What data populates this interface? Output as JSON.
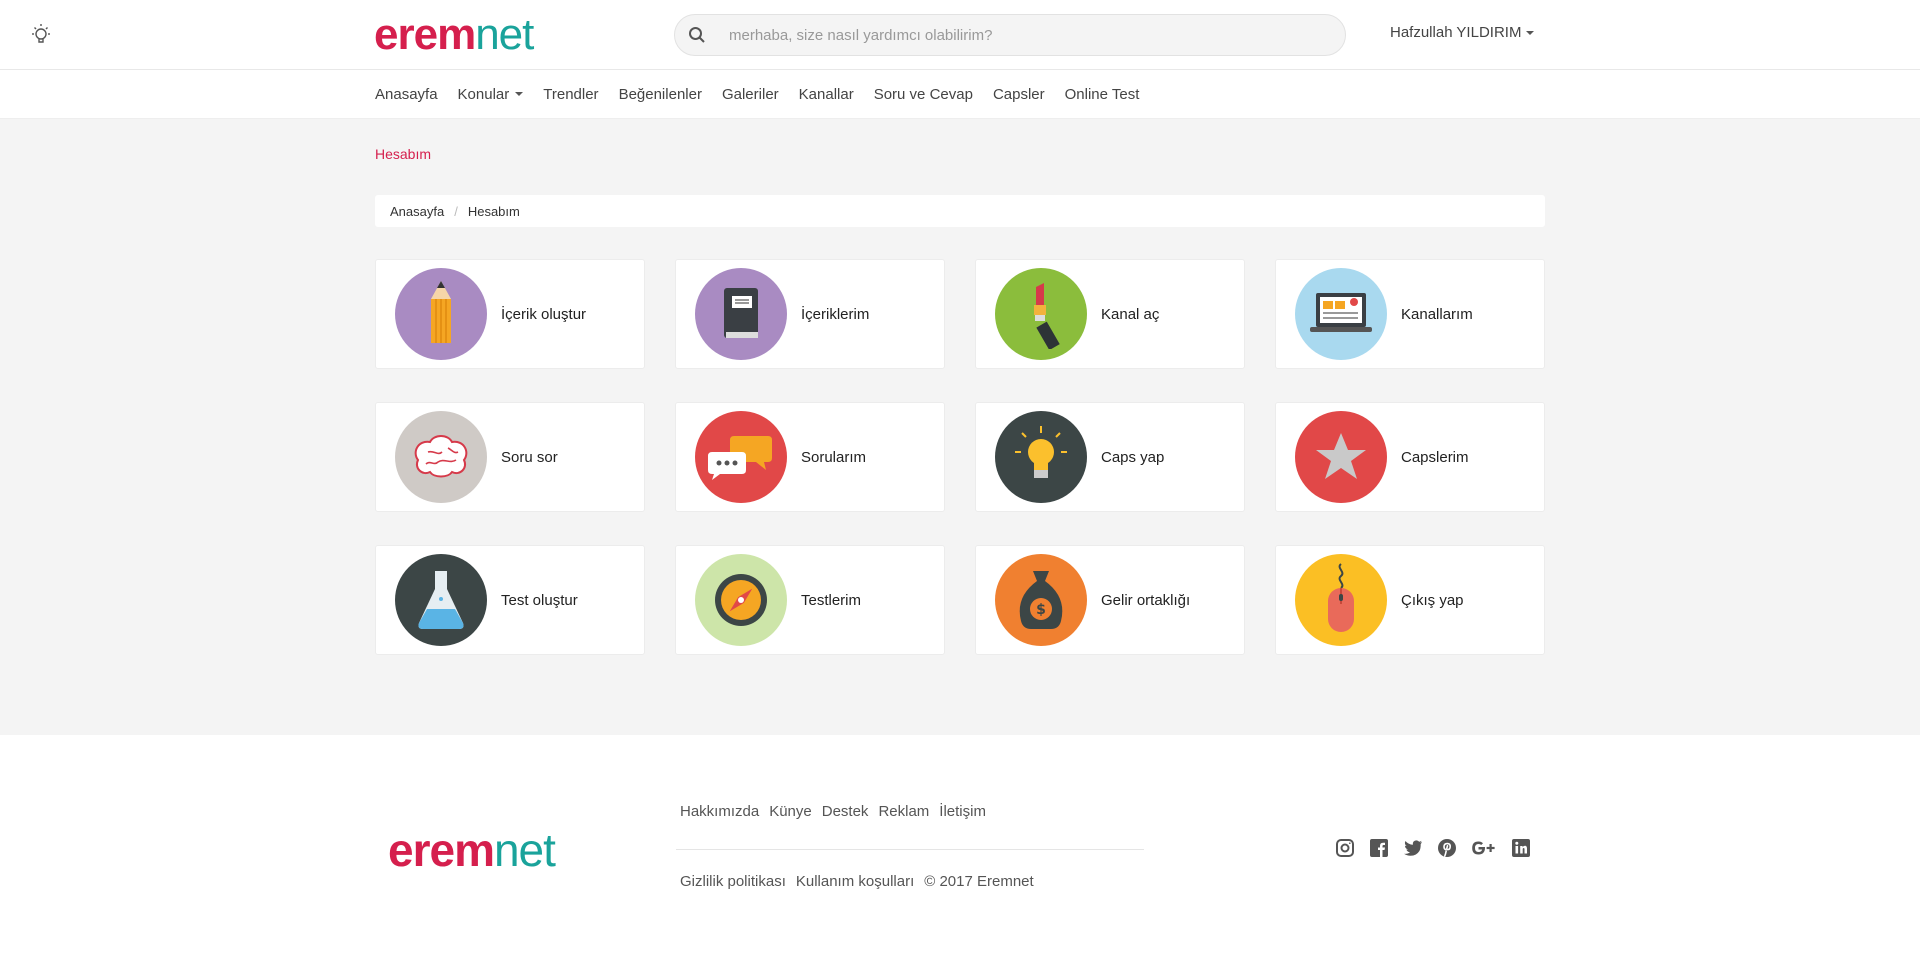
{
  "header": {
    "logo_left": "erem",
    "logo_right": "net",
    "search_placeholder": "merhaba, size nasıl yardımcı olabilirim?",
    "user_name": "Hafzullah YILDIRIM"
  },
  "nav": {
    "items": [
      "Anasayfa",
      "Konular",
      "Trendler",
      "Beğenilenler",
      "Galeriler",
      "Kanallar",
      "Soru ve Cevap",
      "Capsler",
      "Online Test"
    ]
  },
  "page": {
    "title": "Hesabım",
    "breadcrumb": [
      "Anasayfa",
      "Hesabım"
    ]
  },
  "cards": [
    {
      "label": "İçerik oluştur",
      "color": "#a98bc2",
      "icon": "pencil-icon"
    },
    {
      "label": "İçeriklerim",
      "color": "#a98bc2",
      "icon": "book-icon"
    },
    {
      "label": "Kanal aç",
      "color": "#8bbd3c",
      "icon": "lipstick-icon"
    },
    {
      "label": "Kanallarım",
      "color": "#a9d9ef",
      "icon": "laptop-icon"
    },
    {
      "label": "Soru sor",
      "color": "#cfcac6",
      "icon": "brain-icon"
    },
    {
      "label": "Sorularım",
      "color": "#e14848",
      "icon": "chat-bubbles-icon"
    },
    {
      "label": "Caps yap",
      "color": "#3c4646",
      "icon": "lightbulb-icon"
    },
    {
      "label": "Capslerim",
      "color": "#e14848",
      "icon": "star-icon"
    },
    {
      "label": "Test oluştur",
      "color": "#3c4646",
      "icon": "flask-icon"
    },
    {
      "label": "Testlerim",
      "color": "#cde5a9",
      "icon": "compass-icon"
    },
    {
      "label": "Gelir ortaklığı",
      "color": "#f08030",
      "icon": "money-bag-icon"
    },
    {
      "label": "Çıkış yap",
      "color": "#fbbf24",
      "icon": "mouse-icon"
    }
  ],
  "footer": {
    "links_top": [
      "Hakkımızda",
      "Künye",
      "Destek",
      "Reklam",
      "İletişim"
    ],
    "links_bottom": [
      "Gizlilik politikası",
      "Kullanım koşulları",
      "© 2017 Eremnet"
    ]
  }
}
